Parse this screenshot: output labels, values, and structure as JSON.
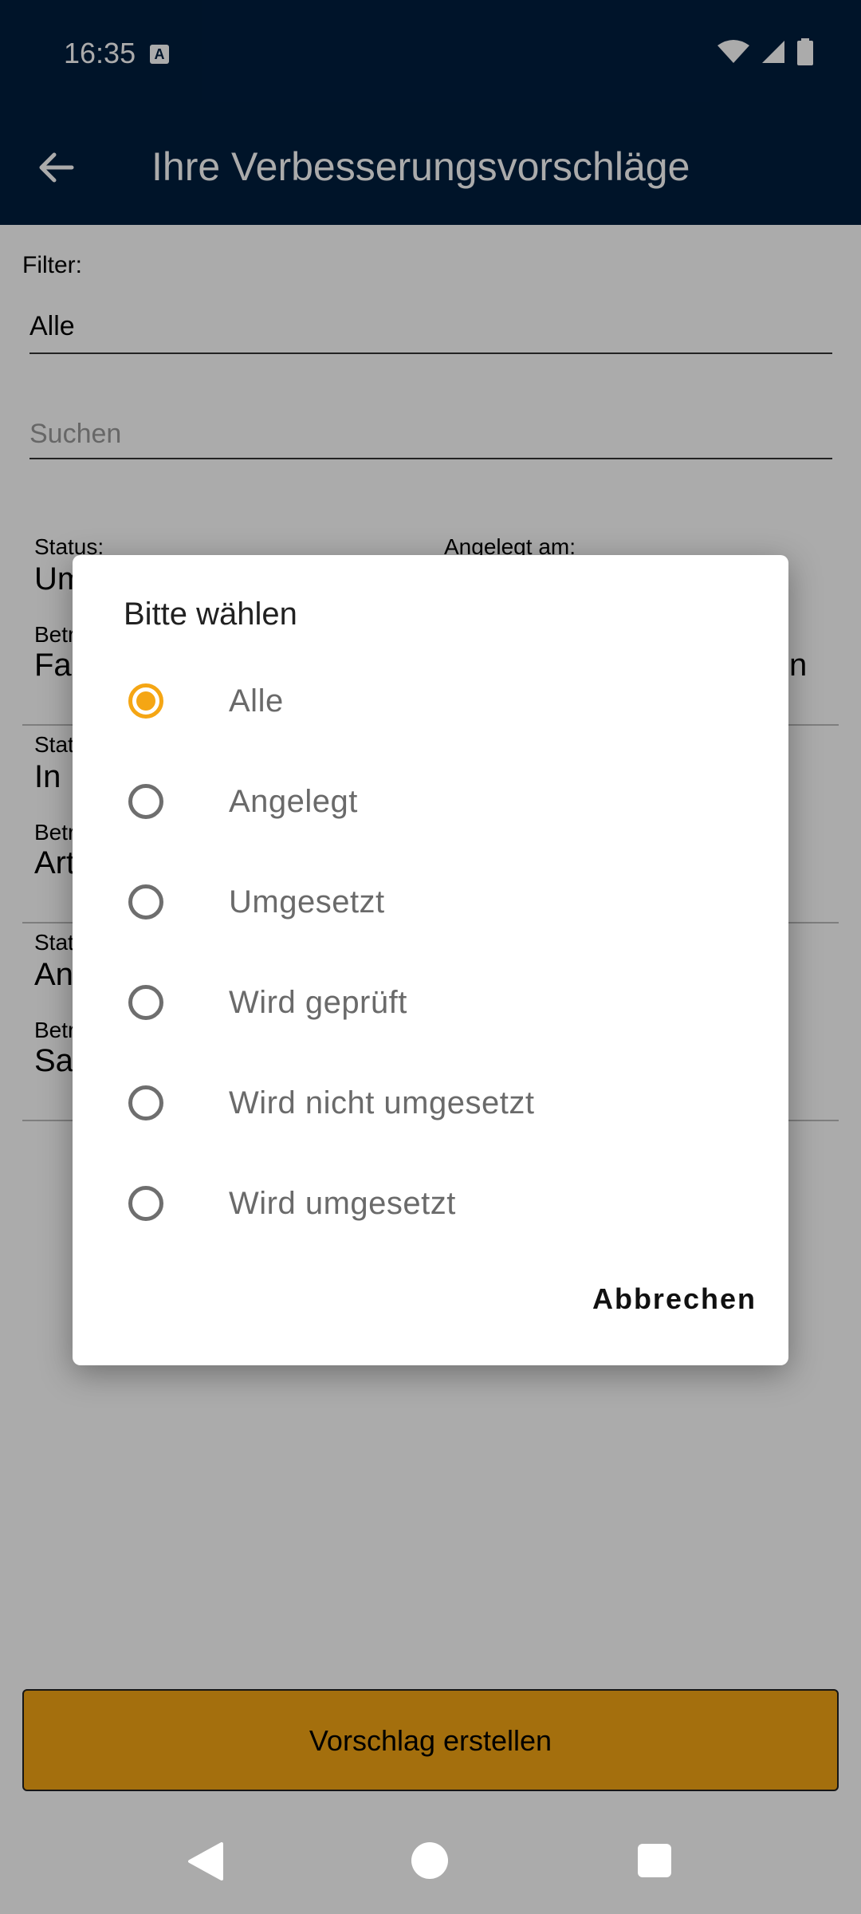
{
  "status_bar": {
    "time": "16:35",
    "keyboard_badge": "A"
  },
  "app_bar": {
    "title": "Ihre Verbesserungsvorschläge"
  },
  "filter": {
    "label": "Filter:",
    "value": "Alle"
  },
  "search": {
    "placeholder": "Suchen"
  },
  "list": {
    "status_label": "Status:",
    "created_label": "Angelegt am:",
    "subject_label": "Betr",
    "items": [
      {
        "status": "Um",
        "subject": "Fa",
        "extra": "n"
      },
      {
        "status_label": "Stat",
        "status": "In I",
        "subject": "Art"
      },
      {
        "status_label": "Stat",
        "status": "An",
        "subject": "Sa"
      }
    ]
  },
  "submit_button": {
    "label": "Vorschlag erstellen"
  },
  "dialog": {
    "title": "Bitte wählen",
    "selected_index": 0,
    "options": [
      "Alle",
      "Angelegt",
      "Umgesetzt",
      "Wird geprüft",
      "Wird nicht umgesetzt",
      "Wird umgesetzt"
    ],
    "cancel_label": "Abbrechen"
  },
  "colors": {
    "app_bar": "#001e3e",
    "accent": "#f5a614",
    "scrim": "rgba(0,0,0,0.33)"
  }
}
